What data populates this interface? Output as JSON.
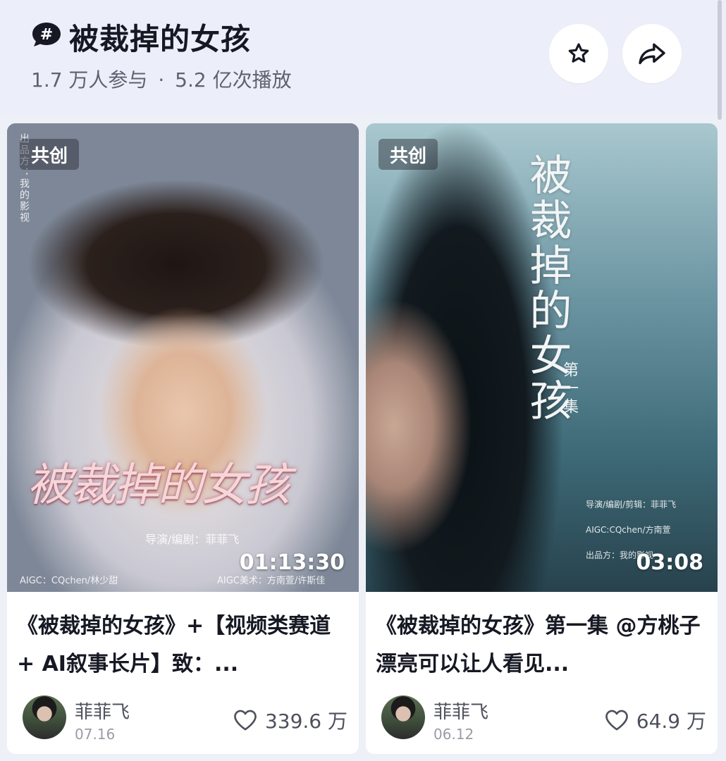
{
  "header": {
    "title": "被裁掉的女孩",
    "participants": "1.7 万人参与",
    "separator": "·",
    "plays": "5.2 亿次播放",
    "icons": {
      "topic": "hashtag-icon",
      "favorite": "star-icon",
      "share": "share-icon"
    }
  },
  "cards": [
    {
      "badge": "共创",
      "duration": "01:13:30",
      "poster": {
        "title": "被裁掉的女孩",
        "credit_director": "导演/编剧：菲菲飞",
        "credit_aigc": "AIGC：CQchen/林少甜",
        "credit_art": "AIGC美术：方南萱/许斯佳",
        "producer_vertical": "出品方：我的影视"
      },
      "title": "《被裁掉的女孩》+【视频类赛道 + AI叙事长片】致：...",
      "author": "菲菲飞",
      "date": "07.16",
      "likes": "339.6 万"
    },
    {
      "badge": "共创",
      "duration": "03:08",
      "poster": {
        "title": "被裁掉的女孩",
        "episode": "第一集",
        "credit_director": "导演/编剧/剪辑：菲菲飞",
        "credit_aigc": "AIGC:CQchen/方南萱",
        "credit_producer": "出品方：我的影视"
      },
      "title": "《被裁掉的女孩》第一集 @方桃子 漂亮可以让人看见...",
      "author": "菲菲飞",
      "date": "06.12",
      "likes": "64.9 万"
    }
  ]
}
